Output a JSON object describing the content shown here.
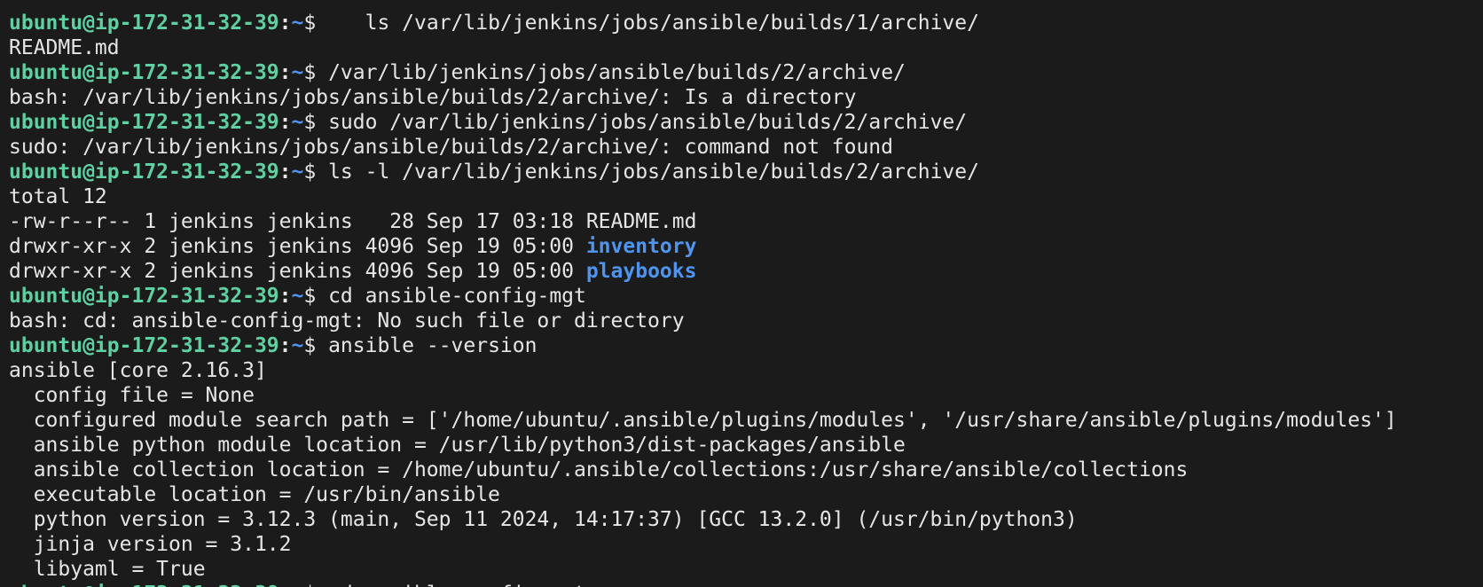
{
  "prompt": {
    "user_host": "ubuntu@ip-172-31-32-39",
    "colon": ":",
    "path": "~",
    "dollar": "$"
  },
  "lines": [
    {
      "type": "command",
      "text": "    ls /var/lib/jenkins/jobs/ansible/builds/1/archive/"
    },
    {
      "type": "output",
      "text": "README.md"
    },
    {
      "type": "command",
      "text": " /var/lib/jenkins/jobs/ansible/builds/2/archive/"
    },
    {
      "type": "output",
      "text": "bash: /var/lib/jenkins/jobs/ansible/builds/2/archive/: Is a directory"
    },
    {
      "type": "command",
      "text": " sudo /var/lib/jenkins/jobs/ansible/builds/2/archive/"
    },
    {
      "type": "output",
      "text": "sudo: /var/lib/jenkins/jobs/ansible/builds/2/archive/: command not found"
    },
    {
      "type": "command",
      "text": " ls -l /var/lib/jenkins/jobs/ansible/builds/2/archive/"
    },
    {
      "type": "output",
      "text": "total 12"
    },
    {
      "type": "listing",
      "meta": "-rw-r--r-- 1 jenkins jenkins   28 Sep 17 03:18 ",
      "name": "README.md",
      "is_dir": false
    },
    {
      "type": "listing",
      "meta": "drwxr-xr-x 2 jenkins jenkins 4096 Sep 19 05:00 ",
      "name": "inventory",
      "is_dir": true
    },
    {
      "type": "listing",
      "meta": "drwxr-xr-x 2 jenkins jenkins 4096 Sep 19 05:00 ",
      "name": "playbooks",
      "is_dir": true
    },
    {
      "type": "command",
      "text": " cd ansible-config-mgt"
    },
    {
      "type": "output",
      "text": "bash: cd: ansible-config-mgt: No such file or directory"
    },
    {
      "type": "command",
      "text": " ansible --version"
    },
    {
      "type": "output",
      "text": "ansible [core 2.16.3]"
    },
    {
      "type": "output",
      "text": "  config file = None"
    },
    {
      "type": "output",
      "text": "  configured module search path = ['/home/ubuntu/.ansible/plugins/modules', '/usr/share/ansible/plugins/modules']"
    },
    {
      "type": "output",
      "text": "  ansible python module location = /usr/lib/python3/dist-packages/ansible"
    },
    {
      "type": "output",
      "text": "  ansible collection location = /home/ubuntu/.ansible/collections:/usr/share/ansible/collections"
    },
    {
      "type": "output",
      "text": "  executable location = /usr/bin/ansible"
    },
    {
      "type": "output",
      "text": "  python version = 3.12.3 (main, Sep 11 2024, 14:17:37) [GCC 13.2.0] (/usr/bin/python3)"
    },
    {
      "type": "output",
      "text": "  jinja version = 3.1.2"
    },
    {
      "type": "output",
      "text": "  libyaml = True"
    },
    {
      "type": "command",
      "text": " cd ansible-config-mgt",
      "partial": true
    }
  ],
  "colors": {
    "background": "#1b1b1b",
    "foreground": "#e6e6e6",
    "prompt_user": "#5fd0a1",
    "prompt_path": "#4f95ee",
    "directory": "#4f95ee"
  }
}
